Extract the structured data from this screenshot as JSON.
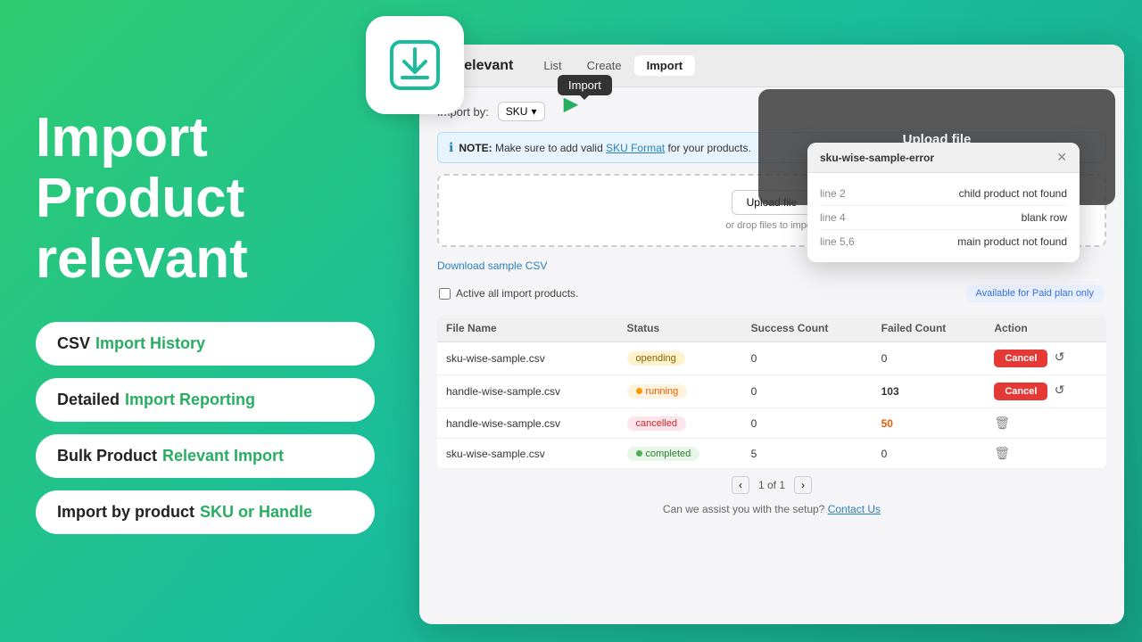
{
  "left": {
    "title": "Import\nProduct\nrelevant",
    "features": [
      {
        "id": "csv-history",
        "prefix": "CSV",
        "suffix": " Import History"
      },
      {
        "id": "detailed-reporting",
        "prefix": "Detailed",
        "suffix": " Import Reporting"
      },
      {
        "id": "bulk-import",
        "prefix": "Bulk Product",
        "suffix": " Relevant Import"
      },
      {
        "id": "sku-handle",
        "prefix": "Import by product",
        "suffix": " SKU or Handle"
      }
    ]
  },
  "appWindow": {
    "windowTitle": "ct Relevant",
    "tabs": [
      "List",
      "Create",
      "Import"
    ],
    "activeTab": "Import",
    "importTooltip": "Import",
    "importByLabel": "Import by:",
    "importByValue": "SKU",
    "noteText": "NOTE:",
    "noteDetail": "Make sure to add valid",
    "noteLinkText": "SKU Format",
    "noteEnd": "for your products.",
    "uploadBtnLabel": "Upload file",
    "uploadHint": "or drop files to import",
    "downloadLink": "Download sample CSV",
    "activeLabel": "Active all import products.",
    "paidBadge": "Available for Paid plan only",
    "tableHeaders": [
      "File Name",
      "Status",
      "Success Count",
      "Failed Count",
      "Action"
    ],
    "tableRows": [
      {
        "fileName": "sku-wise-sample.csv",
        "status": "opending",
        "statusType": "pending",
        "successCount": "0",
        "failedCount": "0",
        "action": "cancel+refresh"
      },
      {
        "fileName": "handle-wise-sample.csv",
        "status": "running",
        "statusType": "running",
        "successCount": "0",
        "failedCount": "103",
        "action": "cancel+refresh"
      },
      {
        "fileName": "handle-wise-sample.csv",
        "status": "cancelled",
        "statusType": "cancelled",
        "successCount": "0",
        "failedCount": "50",
        "action": "delete"
      },
      {
        "fileName": "sku-wise-sample.csv",
        "status": "completed",
        "statusType": "completed",
        "successCount": "5",
        "failedCount": "0",
        "action": "delete"
      }
    ],
    "pagination": "1 of 1",
    "assistText": "Can we assist you with the setup?",
    "contactLink": "Contact Us"
  },
  "uploadPanel": {
    "title": "Upload file",
    "subtitle": "or drop files to import"
  },
  "errorModal": {
    "title": "sku-wise-sample-error",
    "errors": [
      {
        "line": "line 2",
        "message": "child product not found"
      },
      {
        "line": "line 4",
        "message": "blank row"
      },
      {
        "line": "line 5,6",
        "message": "main product not found"
      }
    ]
  }
}
